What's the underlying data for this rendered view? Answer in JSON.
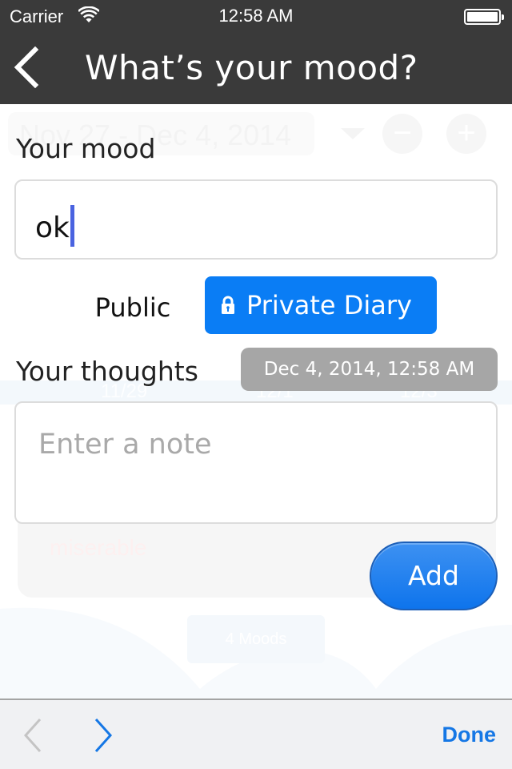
{
  "status_bar": {
    "carrier": "Carrier",
    "time": "12:58 AM",
    "wifi_icon": "wifi-icon",
    "battery_icon": "battery-icon"
  },
  "nav": {
    "title": "What’s your mood?",
    "back_icon": "chevron-left-icon"
  },
  "background": {
    "date_range": "Nov 27 - Dec 4, 2014",
    "dropdown_icon": "triangle-down-icon",
    "minus_label": "−",
    "plus_label": "+",
    "axis_labels": [
      "11/29",
      "12/1",
      "12/3"
    ],
    "entry_mood": "miserable",
    "moods_count": "4 Moods"
  },
  "form": {
    "mood_label": "Your mood",
    "mood_value": "ok",
    "visibility": {
      "public_label": "Public",
      "private_label": "Private Diary",
      "selected": "Private Diary",
      "lock_icon": "lock-icon"
    },
    "thoughts_label": "Your thoughts",
    "date_label": "Dec 4, 2014, 12:58 AM",
    "note_value": "",
    "note_placeholder": "Enter a note",
    "add_label": "Add"
  },
  "toolbar": {
    "prev_icon": "chevron-left-icon",
    "next_icon": "chevron-right-icon",
    "done_label": "Done"
  },
  "colors": {
    "header_bg": "#3a3a3a",
    "accent_blue": "#0a7df5",
    "done_blue": "#1577e5",
    "date_chip_bg": "#a6a6a6",
    "caret": "#4a63e0"
  }
}
